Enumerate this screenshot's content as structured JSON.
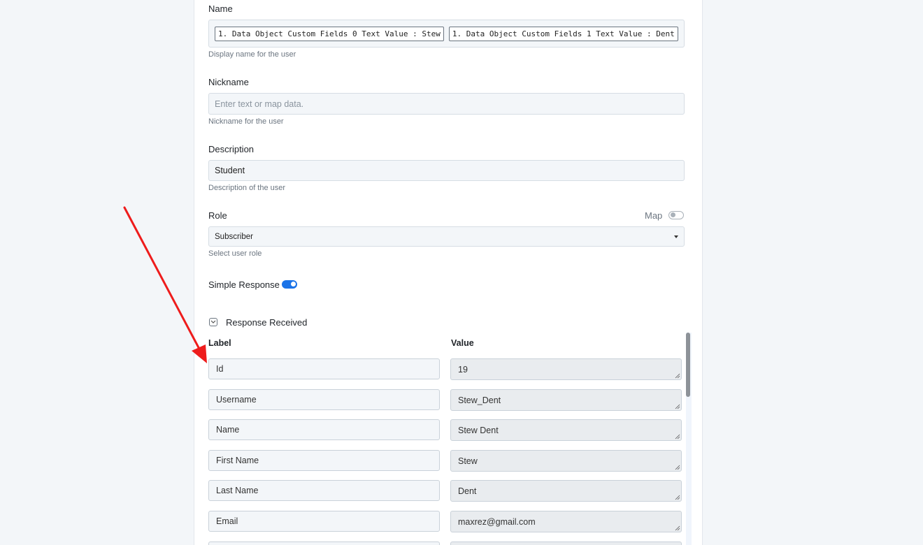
{
  "form": {
    "name": {
      "label": "Name",
      "chips": [
        "1. Data Object Custom Fields 0 Text Value : Stew",
        "1. Data Object Custom Fields 1 Text Value : Dent"
      ],
      "help": "Display name for the user"
    },
    "nickname": {
      "label": "Nickname",
      "placeholder": "Enter text or map data.",
      "help": "Nickname for the user"
    },
    "description": {
      "label": "Description",
      "value": "Student",
      "help": "Description of the user"
    },
    "role": {
      "label": "Role",
      "map_label": "Map",
      "map_enabled": false,
      "selected": "Subscriber",
      "help": "Select user role"
    },
    "simple_response": {
      "label": "Simple Response",
      "enabled": true
    }
  },
  "response": {
    "title": "Response Received",
    "expanded": true,
    "label_header": "Label",
    "value_header": "Value",
    "rows": [
      {
        "label": "Id",
        "value": "19"
      },
      {
        "label": "Username",
        "value": "Stew_Dent"
      },
      {
        "label": "Name",
        "value": "Stew Dent"
      },
      {
        "label": "First Name",
        "value": "Stew"
      },
      {
        "label": "Last Name",
        "value": "Dent"
      },
      {
        "label": "Email",
        "value": "maxrez@gmail.com"
      },
      {
        "label": "",
        "value": ""
      }
    ]
  },
  "colors": {
    "toggle_on": "#1a73e8",
    "annotation_arrow": "#ee1c1c"
  },
  "icons": {
    "collapse": "chevron-down-icon",
    "select": "caret-down-icon",
    "annotation": "red-arrow-annotation"
  }
}
